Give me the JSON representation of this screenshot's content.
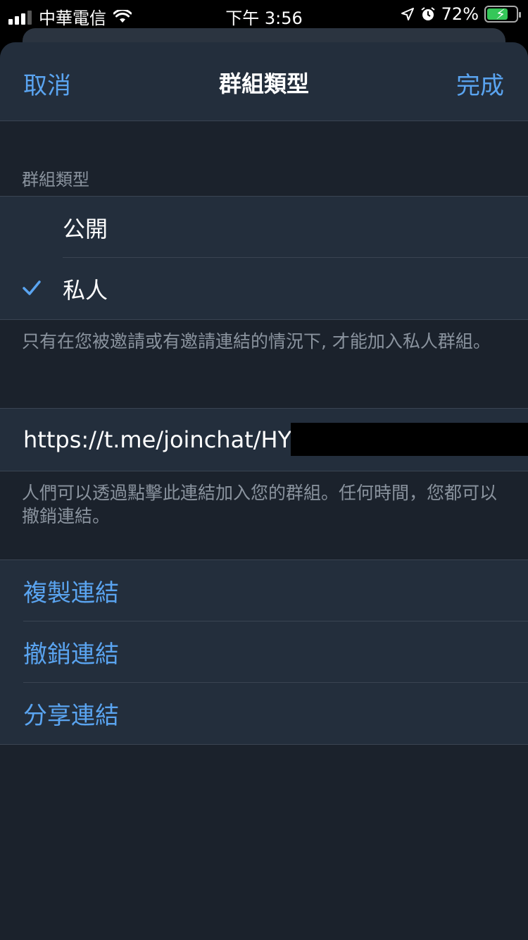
{
  "status_bar": {
    "carrier": "中華電信",
    "time": "下午 3:56",
    "battery": "72%"
  },
  "nav": {
    "cancel": "取消",
    "title": "群組類型",
    "done": "完成"
  },
  "group_type": {
    "section_header": "群組類型",
    "options": [
      {
        "label": "公開",
        "selected": false
      },
      {
        "label": "私人",
        "selected": true
      }
    ],
    "footer": "只有在您被邀請或有邀請連結的情況下, 才能加入私人群組。"
  },
  "invite_link": {
    "url": "https://t.me/joinchat/HYx",
    "footer": "人們可以透過點擊此連結加入您的群組。任何時間，您都可以撤銷連結。"
  },
  "actions": [
    {
      "label": "複製連結"
    },
    {
      "label": "撤銷連結"
    },
    {
      "label": "分享連結"
    }
  ],
  "colors": {
    "accent": "#5aa4f0",
    "background": "#1b222c",
    "cell": "#232e3c"
  }
}
